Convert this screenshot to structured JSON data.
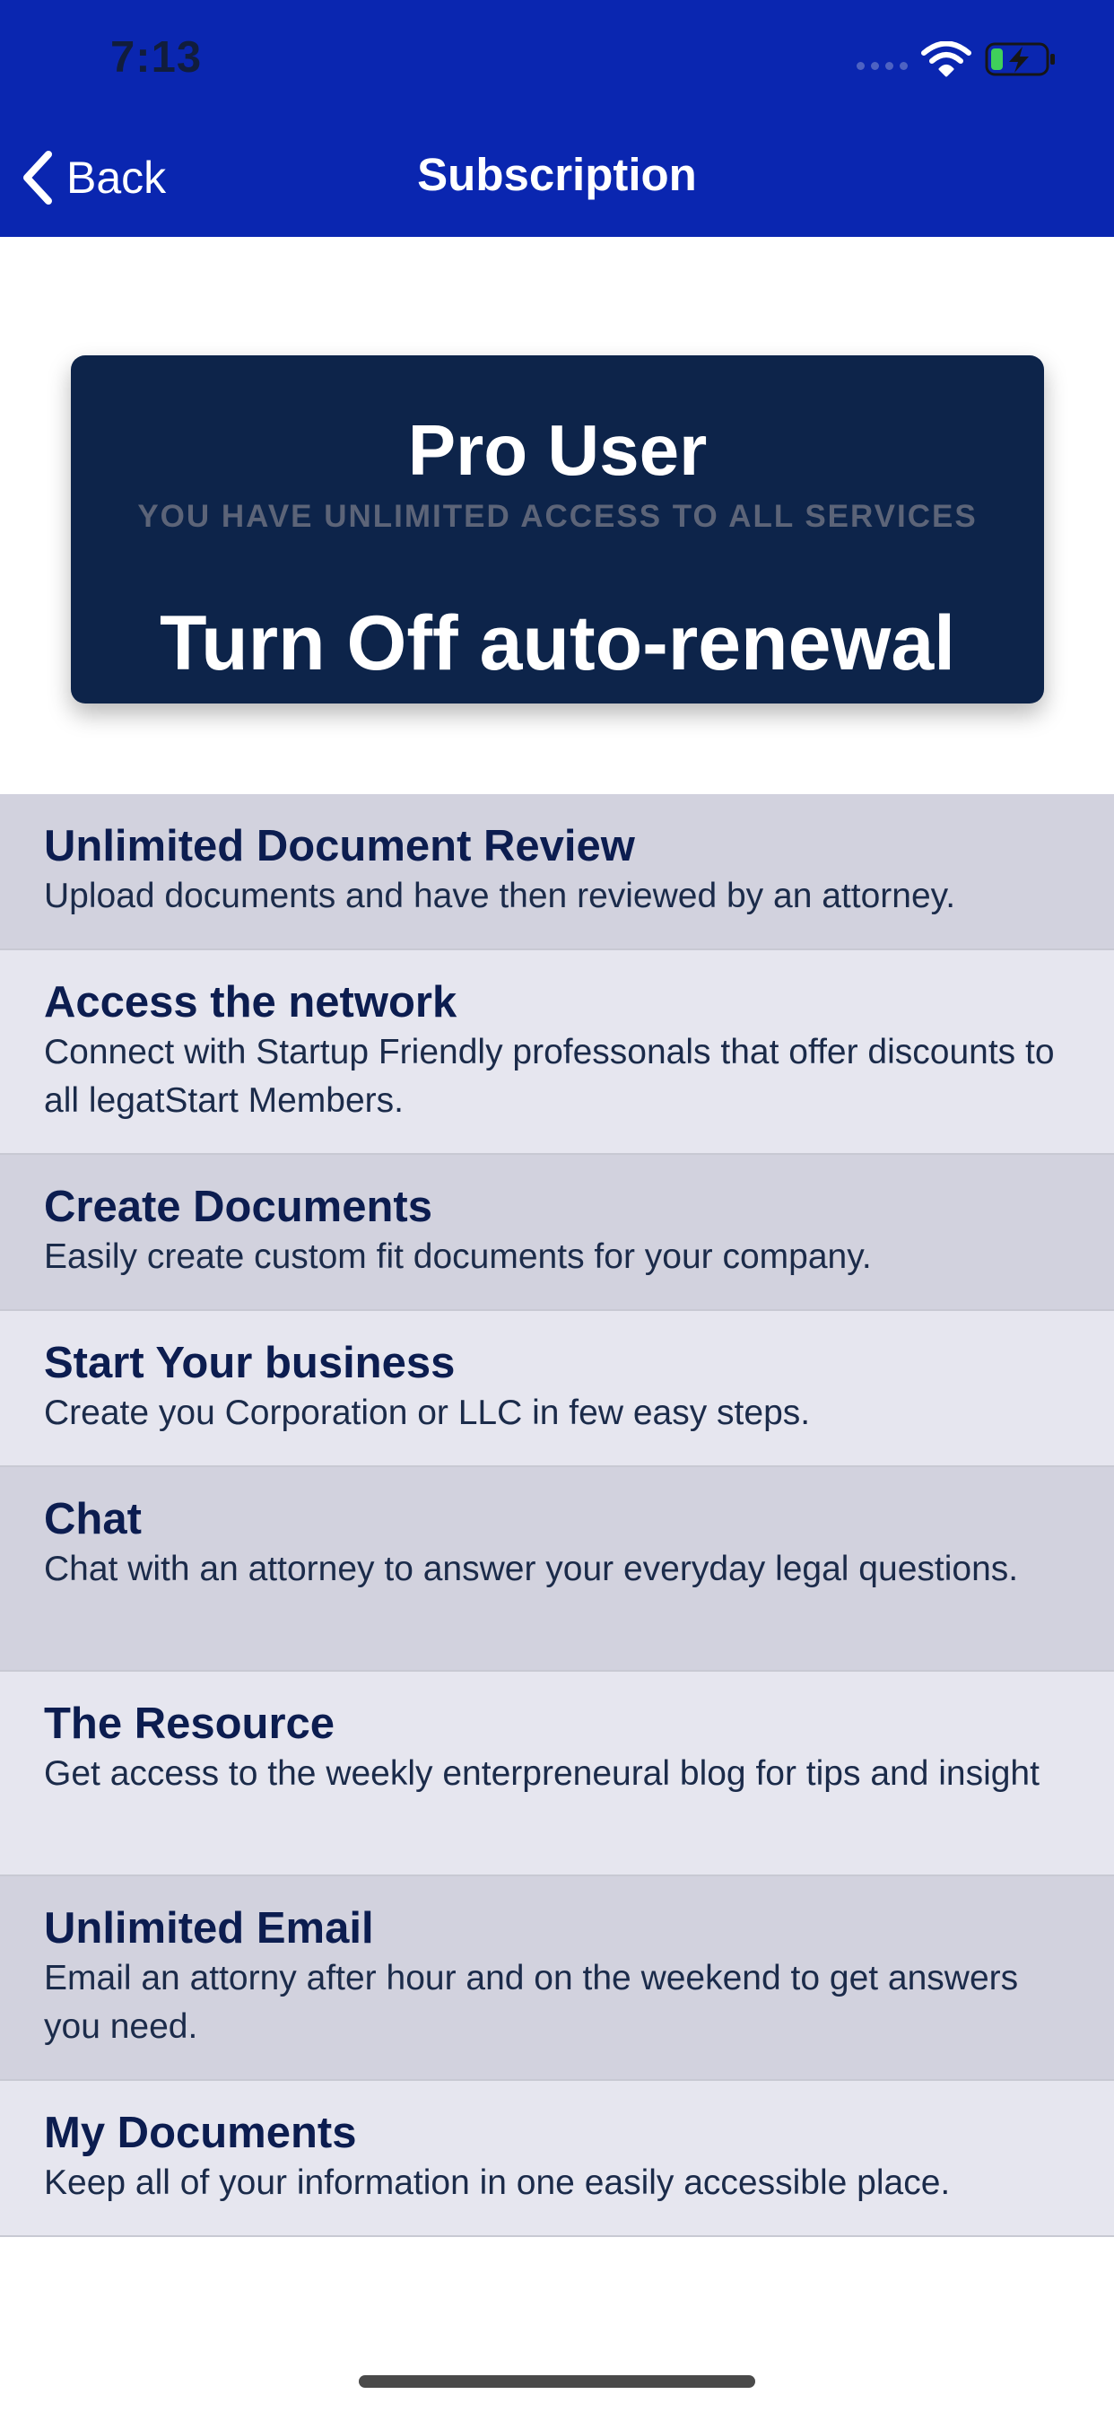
{
  "status_bar": {
    "time": "7:13",
    "icons": [
      "signal-icon",
      "wifi-icon",
      "battery-charging-icon"
    ],
    "battery_color": "#3fd05a"
  },
  "nav": {
    "back_label": "Back",
    "title": "Subscription",
    "background_color": "#0a26b0"
  },
  "pro_card": {
    "title": "Pro User",
    "subtitle": "YOU HAVE UNLIMITED ACCESS TO ALL SERVICES",
    "action_label": "Turn Off auto-renewal",
    "background_color": "#0d244a"
  },
  "features": [
    {
      "title": "Unlimited Document Review",
      "description": "Upload documents and have then reviewed by an attorney."
    },
    {
      "title": "Access the network",
      "description": "Connect with Startup Friendly professonals that offer discounts to all legatStart Members."
    },
    {
      "title": "Create Documents",
      "description": "Easily create custom fit documents for your company."
    },
    {
      "title": "Start Your business",
      "description": "Create you Corporation or LLC in few easy steps."
    },
    {
      "title": "Chat",
      "description": "Chat with an attorney to answer your everyday legal questions."
    },
    {
      "title": "The Resource",
      "description": "Get access to the weekly enterpreneural blog for tips and insight"
    },
    {
      "title": "Unlimited Email",
      "description": "Email an attorny after hour and on the weekend to get answers you need."
    },
    {
      "title": "My Documents",
      "description": "Keep all of your information in one easily accessible place."
    }
  ]
}
